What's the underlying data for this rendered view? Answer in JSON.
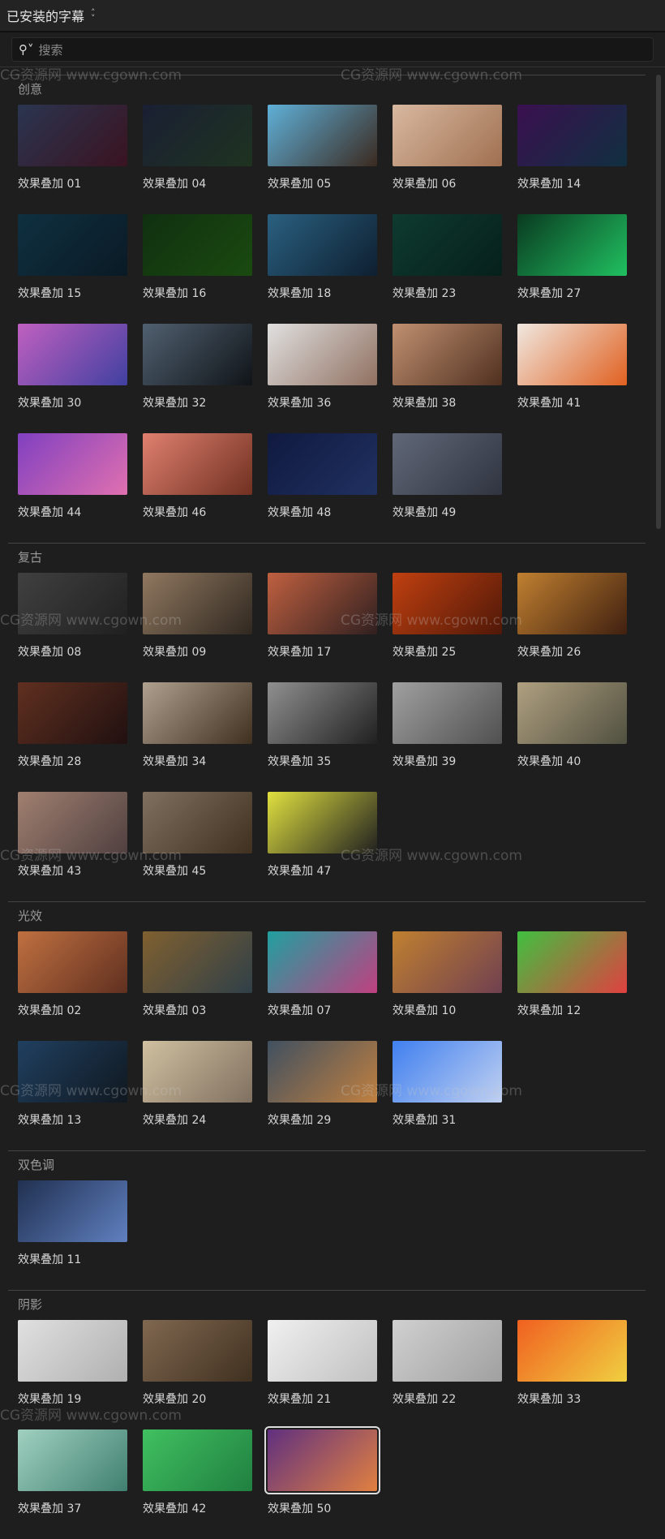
{
  "header": {
    "title": "已安装的字幕"
  },
  "search": {
    "placeholder": "搜索"
  },
  "watermark": "CG资源网 www.cgown.com",
  "sections": [
    {
      "name": "创意",
      "items": [
        {
          "label": "效果叠加 01",
          "colors": [
            "#2a3550",
            "#3a1320"
          ]
        },
        {
          "label": "效果叠加 04",
          "colors": [
            "#1a1f33",
            "#1e3320"
          ]
        },
        {
          "label": "效果叠加 05",
          "colors": [
            "#5fb0d8",
            "#3b2a20"
          ]
        },
        {
          "label": "效果叠加 06",
          "colors": [
            "#d8b8a0",
            "#a07050"
          ]
        },
        {
          "label": "效果叠加 14",
          "colors": [
            "#3a1050",
            "#103040"
          ]
        },
        {
          "label": "效果叠加 15",
          "colors": [
            "#0f3040",
            "#0a1a25"
          ]
        },
        {
          "label": "效果叠加 16",
          "colors": [
            "#103010",
            "#1a4a10"
          ]
        },
        {
          "label": "效果叠加 18",
          "colors": [
            "#2a6080",
            "#0e1f30"
          ]
        },
        {
          "label": "效果叠加 23",
          "colors": [
            "#0e3a30",
            "#06201a"
          ]
        },
        {
          "label": "效果叠加 27",
          "colors": [
            "#0a3a20",
            "#20c060"
          ]
        },
        {
          "label": "效果叠加 30",
          "colors": [
            "#c060c0",
            "#4040a0"
          ]
        },
        {
          "label": "效果叠加 32",
          "colors": [
            "#506070",
            "#101418"
          ]
        },
        {
          "label": "效果叠加 36",
          "colors": [
            "#e0e0e0",
            "#907060"
          ]
        },
        {
          "label": "效果叠加 38",
          "colors": [
            "#c09070",
            "#503020"
          ]
        },
        {
          "label": "效果叠加 41",
          "colors": [
            "#f0e8e0",
            "#e06020"
          ]
        },
        {
          "label": "效果叠加 44",
          "colors": [
            "#8040c0",
            "#e070b0"
          ]
        },
        {
          "label": "效果叠加 46",
          "colors": [
            "#e08070",
            "#703020"
          ]
        },
        {
          "label": "效果叠加 48",
          "colors": [
            "#101a40",
            "#203060"
          ]
        },
        {
          "label": "效果叠加 49",
          "colors": [
            "#606878",
            "#303440"
          ]
        }
      ]
    },
    {
      "name": "复古",
      "items": [
        {
          "label": "效果叠加 08",
          "colors": [
            "#404040",
            "#202020"
          ]
        },
        {
          "label": "效果叠加 09",
          "colors": [
            "#907860",
            "#302820"
          ]
        },
        {
          "label": "效果叠加 17",
          "colors": [
            "#c06040",
            "#302020"
          ]
        },
        {
          "label": "效果叠加 25",
          "colors": [
            "#c04010",
            "#501808"
          ]
        },
        {
          "label": "效果叠加 26",
          "colors": [
            "#c08030",
            "#402010"
          ]
        },
        {
          "label": "效果叠加 28",
          "colors": [
            "#603020",
            "#201010"
          ]
        },
        {
          "label": "效果叠加 34",
          "colors": [
            "#b0a090",
            "#403020"
          ]
        },
        {
          "label": "效果叠加 35",
          "colors": [
            "#909090",
            "#202020"
          ]
        },
        {
          "label": "效果叠加 39",
          "colors": [
            "#a0a0a0",
            "#505050"
          ]
        },
        {
          "label": "效果叠加 40",
          "colors": [
            "#b0a080",
            "#505040"
          ]
        },
        {
          "label": "效果叠加 43",
          "colors": [
            "#a08070",
            "#504040"
          ]
        },
        {
          "label": "效果叠加 45",
          "colors": [
            "#807060",
            "#403020"
          ]
        },
        {
          "label": "效果叠加 47",
          "colors": [
            "#e0e040",
            "#202020"
          ]
        }
      ]
    },
    {
      "name": "光效",
      "items": [
        {
          "label": "效果叠加 02",
          "colors": [
            "#c07040",
            "#603020"
          ]
        },
        {
          "label": "效果叠加 03",
          "colors": [
            "#806030",
            "#304048"
          ]
        },
        {
          "label": "效果叠加 07",
          "colors": [
            "#20a0a0",
            "#c04080"
          ]
        },
        {
          "label": "效果叠加 10",
          "colors": [
            "#c08030",
            "#704050"
          ]
        },
        {
          "label": "效果叠加 12",
          "colors": [
            "#40c040",
            "#e04040"
          ]
        },
        {
          "label": "效果叠加 13",
          "colors": [
            "#204060",
            "#101820"
          ]
        },
        {
          "label": "效果叠加 24",
          "colors": [
            "#d0c0a0",
            "#807060"
          ]
        },
        {
          "label": "效果叠加 29",
          "colors": [
            "#405060",
            "#c08040"
          ]
        },
        {
          "label": "效果叠加 31",
          "colors": [
            "#4080f0",
            "#c0d0f0"
          ]
        }
      ]
    },
    {
      "name": "双色调",
      "items": [
        {
          "label": "效果叠加 11",
          "colors": [
            "#203050",
            "#6080c0"
          ]
        }
      ]
    },
    {
      "name": "阴影",
      "items": [
        {
          "label": "效果叠加 19",
          "colors": [
            "#e0e0e0",
            "#b0b0b0"
          ]
        },
        {
          "label": "效果叠加 20",
          "colors": [
            "#806850",
            "#403020"
          ]
        },
        {
          "label": "效果叠加 21",
          "colors": [
            "#f0f0f0",
            "#c0c0c0"
          ]
        },
        {
          "label": "效果叠加 22",
          "colors": [
            "#d0d0d0",
            "#a0a0a0"
          ]
        },
        {
          "label": "效果叠加 33",
          "colors": [
            "#f06020",
            "#f0d040"
          ]
        },
        {
          "label": "效果叠加 37",
          "colors": [
            "#a0d0c0",
            "#408070"
          ]
        },
        {
          "label": "效果叠加 42",
          "colors": [
            "#40c060",
            "#208040"
          ]
        },
        {
          "label": "效果叠加 50",
          "colors": [
            "#603080",
            "#e08040"
          ],
          "selected": true
        }
      ]
    }
  ]
}
